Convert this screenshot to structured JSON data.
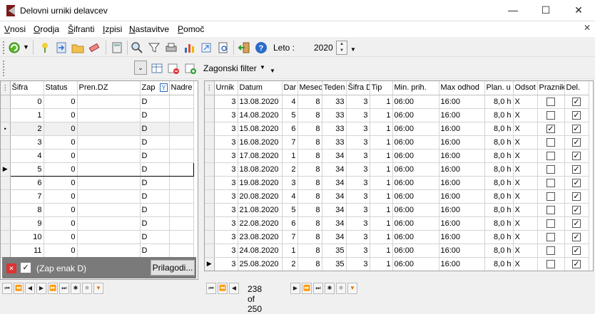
{
  "window": {
    "title": "Delovni urniki delavcev"
  },
  "menu": [
    {
      "label": "Vnosi",
      "u": "V",
      "rest": "nosi"
    },
    {
      "label": "Orodja",
      "u": "O",
      "rest": "rodja"
    },
    {
      "label": "Šifranti",
      "u": "Š",
      "rest": "ifranti"
    },
    {
      "label": "Izpisi",
      "u": "I",
      "rest": "zpisi"
    },
    {
      "label": "Nastavitve",
      "u": "N",
      "rest": "astavitve"
    },
    {
      "label": "Pomoč",
      "u": "P",
      "rest": "omoč"
    }
  ],
  "toolbar": {
    "leto_label": "Leto :",
    "leto_value": "2020"
  },
  "toolbar2": {
    "filter_label": "Zagonski filter"
  },
  "left": {
    "columns": [
      "Šifra",
      "Status",
      "Pren.DZ",
      "Zap",
      "Nadre"
    ],
    "rows": [
      {
        "sifra": "0",
        "status": "0",
        "pren": "",
        "zap": "D",
        "nad": ""
      },
      {
        "sifra": "1",
        "status": "0",
        "pren": "",
        "zap": "D",
        "nad": ""
      },
      {
        "sifra": "2",
        "status": "0",
        "pren": "",
        "zap": "D",
        "nad": ""
      },
      {
        "sifra": "3",
        "status": "0",
        "pren": "",
        "zap": "D",
        "nad": ""
      },
      {
        "sifra": "4",
        "status": "0",
        "pren": "",
        "zap": "D",
        "nad": ""
      },
      {
        "sifra": "5",
        "status": "0",
        "pren": "",
        "zap": "D",
        "nad": ""
      },
      {
        "sifra": "6",
        "status": "0",
        "pren": "",
        "zap": "D",
        "nad": ""
      },
      {
        "sifra": "7",
        "status": "0",
        "pren": "",
        "zap": "D",
        "nad": ""
      },
      {
        "sifra": "8",
        "status": "0",
        "pren": "",
        "zap": "D",
        "nad": ""
      },
      {
        "sifra": "9",
        "status": "0",
        "pren": "",
        "zap": "D",
        "nad": ""
      },
      {
        "sifra": "10",
        "status": "0",
        "pren": "",
        "zap": "D",
        "nad": ""
      },
      {
        "sifra": "11",
        "status": "0",
        "pren": "",
        "zap": "D",
        "nad": ""
      }
    ],
    "filter_text": "(Zap enak D)",
    "filter_button": "Prilagodi..."
  },
  "right": {
    "columns": [
      "Urnik",
      "Datum",
      "Dar",
      "Mesec",
      "Teden",
      "Šifra D",
      "Tip",
      "Min. prih.",
      "Max odhod",
      "Plan. u",
      "Odsot",
      "Praznik",
      "Del."
    ],
    "rows": [
      {
        "u": "3",
        "d": "13.08.2020",
        "dn": "4",
        "m": "8",
        "t": "33",
        "s": "3",
        "tip": "1",
        "min": "06:00",
        "max": "16:00",
        "p": "8,0 h",
        "o": "X",
        "pr": false,
        "del": true
      },
      {
        "u": "3",
        "d": "14.08.2020",
        "dn": "5",
        "m": "8",
        "t": "33",
        "s": "3",
        "tip": "1",
        "min": "06:00",
        "max": "16:00",
        "p": "8,0 h",
        "o": "X",
        "pr": false,
        "del": true
      },
      {
        "u": "3",
        "d": "15.08.2020",
        "dn": "6",
        "m": "8",
        "t": "33",
        "s": "3",
        "tip": "1",
        "min": "06:00",
        "max": "16:00",
        "p": "8,0 h",
        "o": "X",
        "pr": true,
        "del": true
      },
      {
        "u": "3",
        "d": "16.08.2020",
        "dn": "7",
        "m": "8",
        "t": "33",
        "s": "3",
        "tip": "1",
        "min": "06:00",
        "max": "16:00",
        "p": "8,0 h",
        "o": "X",
        "pr": false,
        "del": true
      },
      {
        "u": "3",
        "d": "17.08.2020",
        "dn": "1",
        "m": "8",
        "t": "34",
        "s": "3",
        "tip": "1",
        "min": "06:00",
        "max": "16:00",
        "p": "8,0 h",
        "o": "X",
        "pr": false,
        "del": true
      },
      {
        "u": "3",
        "d": "18.08.2020",
        "dn": "2",
        "m": "8",
        "t": "34",
        "s": "3",
        "tip": "1",
        "min": "06:00",
        "max": "16:00",
        "p": "8,0 h",
        "o": "X",
        "pr": false,
        "del": true
      },
      {
        "u": "3",
        "d": "19.08.2020",
        "dn": "3",
        "m": "8",
        "t": "34",
        "s": "3",
        "tip": "1",
        "min": "06:00",
        "max": "16:00",
        "p": "8,0 h",
        "o": "X",
        "pr": false,
        "del": true
      },
      {
        "u": "3",
        "d": "20.08.2020",
        "dn": "4",
        "m": "8",
        "t": "34",
        "s": "3",
        "tip": "1",
        "min": "06:00",
        "max": "16:00",
        "p": "8,0 h",
        "o": "X",
        "pr": false,
        "del": true
      },
      {
        "u": "3",
        "d": "21.08.2020",
        "dn": "5",
        "m": "8",
        "t": "34",
        "s": "3",
        "tip": "1",
        "min": "06:00",
        "max": "16:00",
        "p": "8,0 h",
        "o": "X",
        "pr": false,
        "del": true
      },
      {
        "u": "3",
        "d": "22.08.2020",
        "dn": "6",
        "m": "8",
        "t": "34",
        "s": "3",
        "tip": "1",
        "min": "06:00",
        "max": "16:00",
        "p": "8,0 h",
        "o": "X",
        "pr": false,
        "del": true
      },
      {
        "u": "3",
        "d": "23.08.2020",
        "dn": "7",
        "m": "8",
        "t": "34",
        "s": "3",
        "tip": "1",
        "min": "06:00",
        "max": "16:00",
        "p": "8,0 h",
        "o": "X",
        "pr": false,
        "del": true
      },
      {
        "u": "3",
        "d": "24.08.2020",
        "dn": "1",
        "m": "8",
        "t": "35",
        "s": "3",
        "tip": "1",
        "min": "06:00",
        "max": "16:00",
        "p": "8,0 h",
        "o": "X",
        "pr": false,
        "del": true
      },
      {
        "u": "3",
        "d": "25.08.2020",
        "dn": "2",
        "m": "8",
        "t": "35",
        "s": "3",
        "tip": "1",
        "min": "06:00",
        "max": "16:00",
        "p": "8,0 h",
        "o": "X",
        "pr": false,
        "del": true
      }
    ],
    "record_count": "238 of 250"
  },
  "colors": {
    "accent": "#2a6cc9",
    "filter_bar": "#7a7a7a",
    "filter_x": "#dd3333"
  }
}
